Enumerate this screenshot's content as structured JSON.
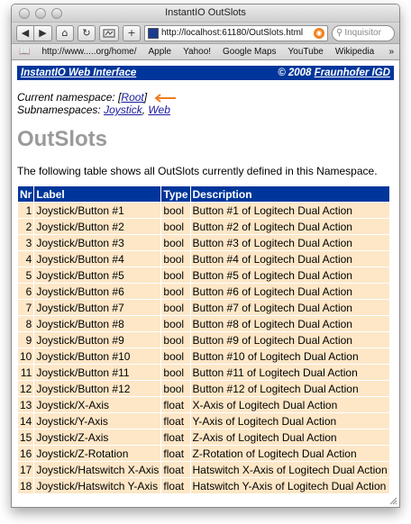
{
  "window": {
    "title": "InstantIO OutSlots"
  },
  "toolbar": {
    "back_label": "◀",
    "forward_label": "▶",
    "home_label": "⌂",
    "reload_label": "↻",
    "addtab_label": "+",
    "url": "http://localhost:61180/OutSlots.html",
    "search_placeholder": "Inquisitor"
  },
  "bookmarks": [
    "http://www.....org/home/",
    "Apple",
    "Yahoo!",
    "Google Maps",
    "YouTube",
    "Wikipedia"
  ],
  "banner": {
    "left": "InstantIO Web Interface",
    "right_prefix": "© 2008 ",
    "right_link": "Fraunhofer IGD"
  },
  "namespace": {
    "current_label": "Current namespace: ",
    "current_link": "Root",
    "sub_label": "Subnamespaces: ",
    "sub_links": [
      "Joystick",
      "Web"
    ]
  },
  "page": {
    "heading": "OutSlots",
    "intro": "The following table shows all OutSlots currently defined in this Namespace."
  },
  "table": {
    "headers": [
      "Nr",
      "Label",
      "Type",
      "Description"
    ],
    "rows": [
      [
        "1",
        "Joystick/Button #1",
        "bool",
        "Button #1 of Logitech Dual Action"
      ],
      [
        "2",
        "Joystick/Button #2",
        "bool",
        "Button #2 of Logitech Dual Action"
      ],
      [
        "3",
        "Joystick/Button #3",
        "bool",
        "Button #3 of Logitech Dual Action"
      ],
      [
        "4",
        "Joystick/Button #4",
        "bool",
        "Button #4 of Logitech Dual Action"
      ],
      [
        "5",
        "Joystick/Button #5",
        "bool",
        "Button #5 of Logitech Dual Action"
      ],
      [
        "6",
        "Joystick/Button #6",
        "bool",
        "Button #6 of Logitech Dual Action"
      ],
      [
        "7",
        "Joystick/Button #7",
        "bool",
        "Button #7 of Logitech Dual Action"
      ],
      [
        "8",
        "Joystick/Button #8",
        "bool",
        "Button #8 of Logitech Dual Action"
      ],
      [
        "9",
        "Joystick/Button #9",
        "bool",
        "Button #9 of Logitech Dual Action"
      ],
      [
        "10",
        "Joystick/Button #10",
        "bool",
        "Button #10 of Logitech Dual Action"
      ],
      [
        "11",
        "Joystick/Button #11",
        "bool",
        "Button #11 of Logitech Dual Action"
      ],
      [
        "12",
        "Joystick/Button #12",
        "bool",
        "Button #12 of Logitech Dual Action"
      ],
      [
        "13",
        "Joystick/X-Axis",
        "float",
        "X-Axis of Logitech Dual Action"
      ],
      [
        "14",
        "Joystick/Y-Axis",
        "float",
        "Y-Axis of Logitech Dual Action"
      ],
      [
        "15",
        "Joystick/Z-Axis",
        "float",
        "Z-Axis of Logitech Dual Action"
      ],
      [
        "16",
        "Joystick/Z-Rotation",
        "float",
        "Z-Rotation of Logitech Dual Action"
      ],
      [
        "17",
        "Joystick/Hatswitch X-Axis",
        "float",
        "Hatswitch X-Axis of Logitech Dual Action"
      ],
      [
        "18",
        "Joystick/Hatswitch Y-Axis",
        "float",
        "Hatswitch Y-Axis of Logitech Dual Action"
      ]
    ]
  },
  "colors": {
    "banner": "#00369b",
    "row_bg": "#fde7c7",
    "arrow": "#f07d1e",
    "heading": "#9a9a9a"
  }
}
